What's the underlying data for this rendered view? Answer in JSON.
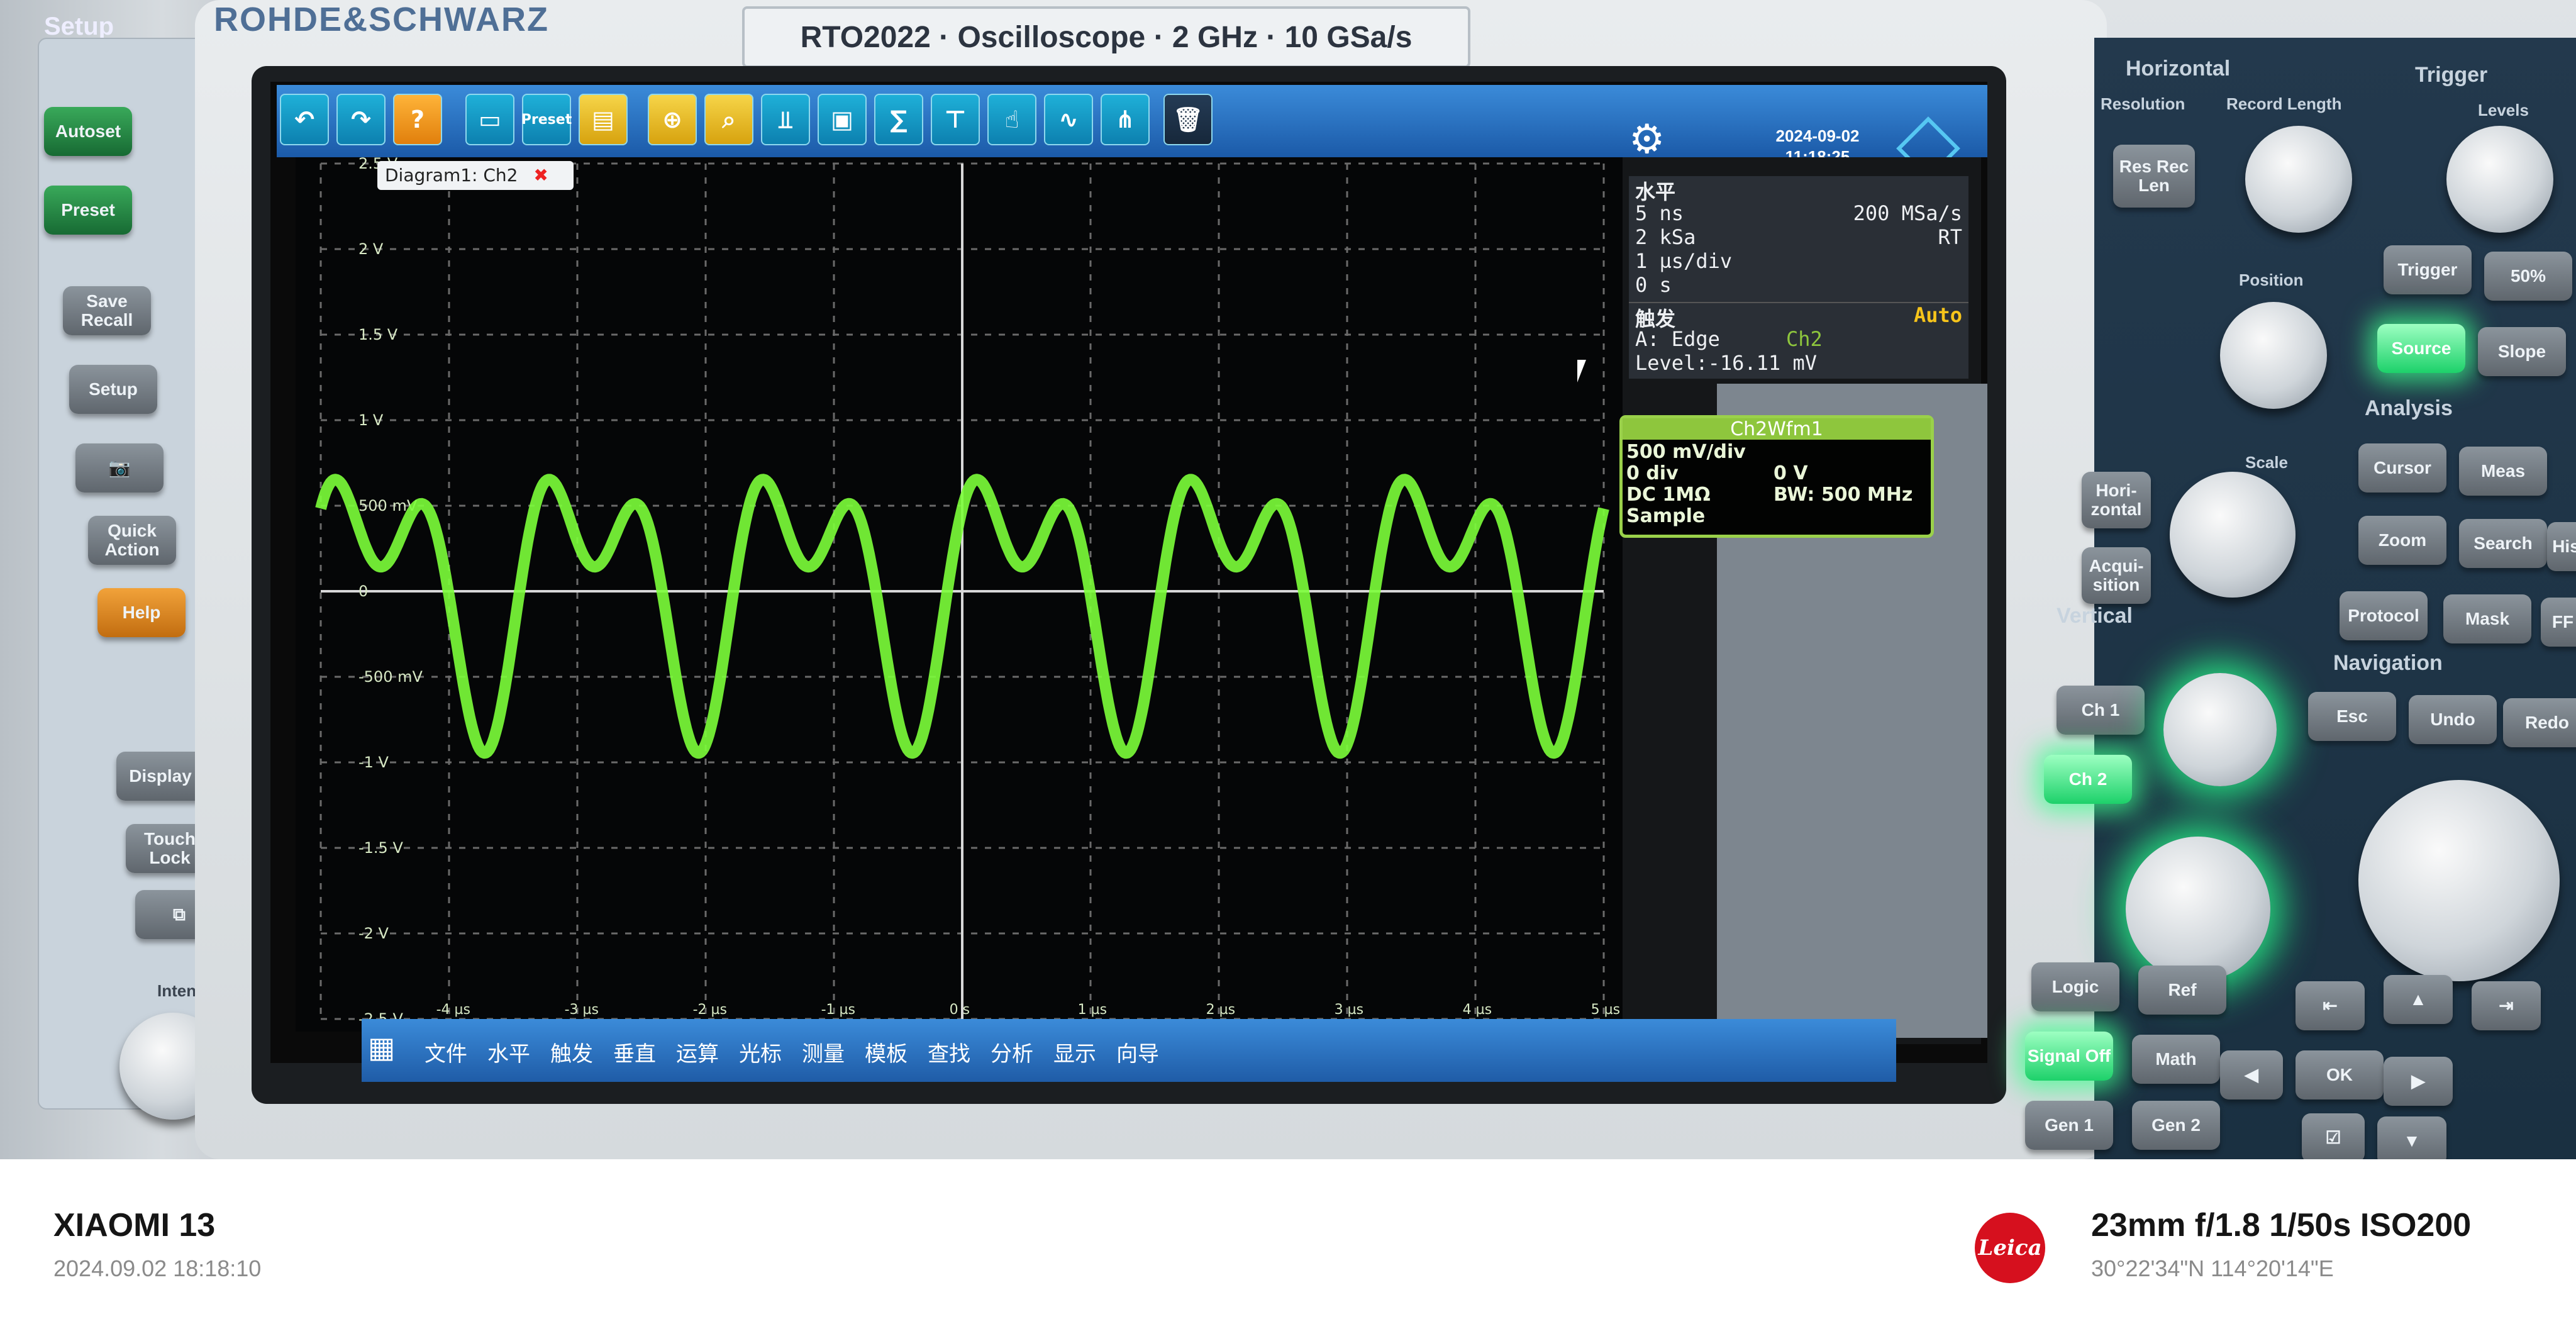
{
  "device": {
    "brand": "ROHDE&SCHWARZ",
    "model_label": "RTO2022 · Oscilloscope · 2 GHz · 10 GSa/s"
  },
  "left_panel": {
    "title": "Setup",
    "buttons": [
      "Autoset",
      "Preset",
      "Save Recall",
      "Setup",
      "Quick Action",
      "Help",
      "Display",
      "Touch Lock"
    ],
    "intensity_label": "Intensity"
  },
  "screen": {
    "date": "2024-09-02",
    "time": "11:18:25",
    "diagram_tab": "Diagram1: Ch2",
    "horizontal": {
      "title": "水平",
      "time_per_point": "5 ns",
      "samples": "2 kSa",
      "time_div": "1 µs/div",
      "position": "0 s",
      "sample_rate": "200 MSa/s",
      "mode": "RT"
    },
    "trigger": {
      "title": "触发",
      "mode": "Auto",
      "line1": "A:    Edge",
      "source": "Ch2",
      "level": "Level:-16.11 mV"
    },
    "channel_box": {
      "name": "Ch2Wfm1",
      "scale": "500 mV/div",
      "offset": "0 div",
      "offset_value": "0 V",
      "coupling": "DC 1MΩ",
      "bw": "BW: 500 MHz",
      "mode": "Sample"
    },
    "bottom_menu": [
      "文件",
      "水平",
      "触发",
      "垂直",
      "运算",
      "光标",
      "测量",
      "模板",
      "查找",
      "分析",
      "显示",
      "向导"
    ],
    "y_labels": [
      "2.5 V",
      "2 V",
      "1.5 V",
      "1 V",
      "500 mV",
      "0",
      "-500 mV",
      "-1 V",
      "-1.5 V",
      "-2 V",
      "-2.5 V"
    ],
    "x_labels": [
      "-4 µs",
      "-3 µs",
      "-2 µs",
      "-1 µs",
      "0 s",
      "1 µs",
      "2 µs",
      "3 µs",
      "4 µs",
      "5 µs"
    ]
  },
  "right_panel": {
    "horizontal_title": "Horizontal",
    "resolution": "Resolution",
    "record_length": "Record Length",
    "trigger_title": "Trigger",
    "levels": "Levels",
    "position": "Position",
    "scale": "Scale",
    "vertical_title": "Vertical",
    "analysis_title": "Analysis",
    "navigation_title": "Navigation",
    "buttons": {
      "res_rec_len": "Res Rec Len",
      "trigger": "Trigger",
      "fifty": "50%",
      "source": "Source",
      "slope": "Slope",
      "horizontal": "Hori- zontal",
      "acquisition": "Acqui- sition",
      "cursor": "Cursor",
      "meas": "Meas",
      "zoom": "Zoom",
      "search": "Search",
      "hist": "His",
      "protocol": "Protocol",
      "mask": "Mask",
      "ff": "FF",
      "ch1": "Ch 1",
      "ch2": "Ch 2",
      "esc": "Esc",
      "undo": "Undo",
      "redo": "Redo",
      "logic": "Logic",
      "ref": "Ref",
      "signal_off": "Signal Off",
      "math": "Math",
      "gen1": "Gen 1",
      "gen2": "Gen 2",
      "ok": "OK"
    }
  },
  "caption": {
    "camera": "XIAOMI 13",
    "datetime": "2024.09.02  18:18:10",
    "params": "23mm  f/1.8  1/50s  ISO200",
    "gps": "30°22'34\"N  114°20'14\"E",
    "logo": "Leica"
  },
  "colors": {
    "trace": "#7cff3a",
    "accent_blue": "#1b5aa8"
  }
}
